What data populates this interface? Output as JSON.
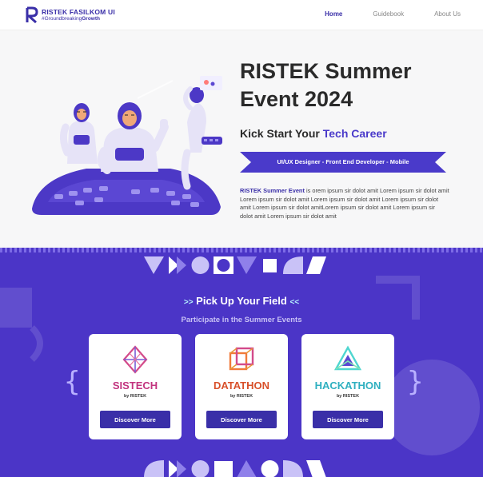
{
  "nav": {
    "brand": "RISTEK FASILKOM UI",
    "tagline_prefix": "#Groundbreaking",
    "tagline_bold": "Growth",
    "links": [
      "Home",
      "Guidebook",
      "About Us"
    ]
  },
  "hero": {
    "title_line1": "RISTEK Summer",
    "title_line2": "Event 2024",
    "subtitle_prefix": "Kick Start Your ",
    "subtitle_highlight": "Tech Career",
    "roles": "UI/UX Designer  -  Front End Developer  -  Mobile",
    "desc_bold": "RISTEK Summer Event",
    "desc_rest": " is orem ipsum sir dolot amit Lorem ipsum sir dolot amit Lorem ipsum sir dolot amit Lorem ipsum sir dolot amit Lorem ipsum sir dolot amit Lorem ipsum sir dolot amitLorem ipsum sir dolot amit Lorem ipsum sir dolot amit Lorem ipsum sir dolot amit"
  },
  "events": {
    "title": "Pick Up Your Field",
    "subtitle": "Participate in the Summer Events",
    "brace_left": "{",
    "brace_right": "}",
    "cards": [
      {
        "name": "SISTECH",
        "by": "by RISTEK",
        "button": "Discover More"
      },
      {
        "name": "DATATHON",
        "by": "by RISTEK",
        "button": "Discover More"
      },
      {
        "name": "HACKATHON",
        "by": "by RISTEK",
        "button": "Discover More"
      }
    ]
  },
  "colors": {
    "brand": "#3a2fa8",
    "section_bg": "#4b35c7",
    "accent_light": "#b6f3ff"
  }
}
